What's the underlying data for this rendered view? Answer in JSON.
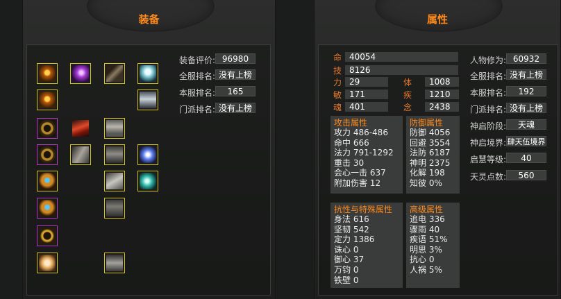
{
  "equip": {
    "title": "装备",
    "fields": [
      {
        "label": "装备评价:",
        "value": "96980"
      },
      {
        "label": "全服排名:",
        "value": "没有上榜"
      },
      {
        "label": "本服排名:",
        "value": "165"
      },
      {
        "label": "门派排名:",
        "value": "没有上榜"
      }
    ],
    "slots": [
      {
        "name": "amulet-gold-icon",
        "quality": "gold",
        "art": "amulet"
      },
      {
        "name": "orb-purple-icon",
        "quality": "gold",
        "art": "orb"
      },
      {
        "name": "boots-icon",
        "quality": "gold",
        "art": "boots"
      },
      {
        "name": "crane-mount-icon",
        "quality": "gold",
        "art": "crane"
      },
      {
        "name": "amulet-gold-2-icon",
        "quality": "gold",
        "art": "amulet"
      },
      {
        "name": "figure-icon",
        "quality": "gold",
        "art": "figure"
      },
      {
        "name": "ring-bronze-icon",
        "quality": "purple",
        "art": "hoop"
      },
      {
        "name": "red-plume-icon",
        "quality": "none",
        "art": "plume"
      },
      {
        "name": "chest-armor-icon",
        "quality": "gold",
        "art": "armor"
      },
      {
        "name": "ring-bronze-2-icon",
        "quality": "purple",
        "art": "hoop"
      },
      {
        "name": "bracer-icon",
        "quality": "gold",
        "art": "bracer"
      },
      {
        "name": "belt-armor-icon",
        "quality": "gold",
        "art": "belt"
      },
      {
        "name": "blue-spirit-icon",
        "quality": "gold",
        "art": "spirit"
      },
      {
        "name": "gem-ring-icon",
        "quality": "gold",
        "art": "gemring"
      },
      {
        "name": "shoulder-icon",
        "quality": "gold",
        "art": "shoulder"
      },
      {
        "name": "teal-dragon-icon",
        "quality": "gold",
        "art": "dragon"
      },
      {
        "name": "gem-ring-2-icon",
        "quality": "purple",
        "art": "gemring"
      },
      {
        "name": "leg-armor-icon",
        "quality": "gold",
        "art": "legs"
      },
      {
        "name": "necklace-icon",
        "quality": "purple",
        "art": "necklace"
      },
      {
        "name": "scroll-icon",
        "quality": "gold",
        "art": "scroll"
      },
      {
        "name": "boots-2-icon",
        "quality": "gold",
        "art": "boots2"
      }
    ]
  },
  "attr": {
    "title": "属性",
    "hp": {
      "label": "命",
      "value": "40054"
    },
    "skill": {
      "label": "技",
      "value": "8126"
    },
    "pairs": [
      {
        "l1": "力",
        "v1": "29",
        "l2": "体",
        "v2": "1008"
      },
      {
        "l1": "敏",
        "v1": "171",
        "l2": "疾",
        "v2": "1210"
      },
      {
        "l1": "魂",
        "v1": "401",
        "l2": "念",
        "v2": "2438"
      }
    ],
    "attack": {
      "heading": "攻击属性",
      "rows": [
        "攻力 486-486",
        "命中 666",
        "法力 791-1292",
        "重击 30",
        "会心一击 637",
        "附加伤害 12"
      ]
    },
    "defense": {
      "heading": "防御属性",
      "rows": [
        "防御 4056",
        "回避 3554",
        "法防 6187",
        "神明 2375",
        "化解 198",
        "知彼 0%"
      ]
    },
    "resist": {
      "heading": "抗性与特殊属性",
      "rows": [
        "身法 616",
        "坚韧 542",
        "定力 1386",
        "诛心 0",
        "御心 37",
        "万钧 0",
        "铁壁 0"
      ]
    },
    "advanced": {
      "heading": "高级属性",
      "rows": [
        "追电 336",
        "骤雨 40",
        "疾语 51%",
        "明思 3%",
        "抗心 0",
        "人祸 5%"
      ]
    },
    "side": [
      {
        "label": "人物修为:",
        "value": "60932"
      },
      {
        "label": "全服排名:",
        "value": "没有上榜"
      },
      {
        "label": "本服排名:",
        "value": "192"
      },
      {
        "label": "门派排名:",
        "value": "没有上榜"
      },
      {
        "label": "神启阶段:",
        "value": "天魂"
      },
      {
        "label": "神启境界:",
        "value": "肆天伍境界"
      },
      {
        "label": "启慧等级:",
        "value": "40"
      },
      {
        "label": "天灵点数:",
        "value": "560"
      }
    ]
  },
  "colors": {
    "accent": "#ff8a1c",
    "stat_label": "#e8792c",
    "gold_border": "#d8c51a",
    "purple_border": "#b637c3"
  }
}
